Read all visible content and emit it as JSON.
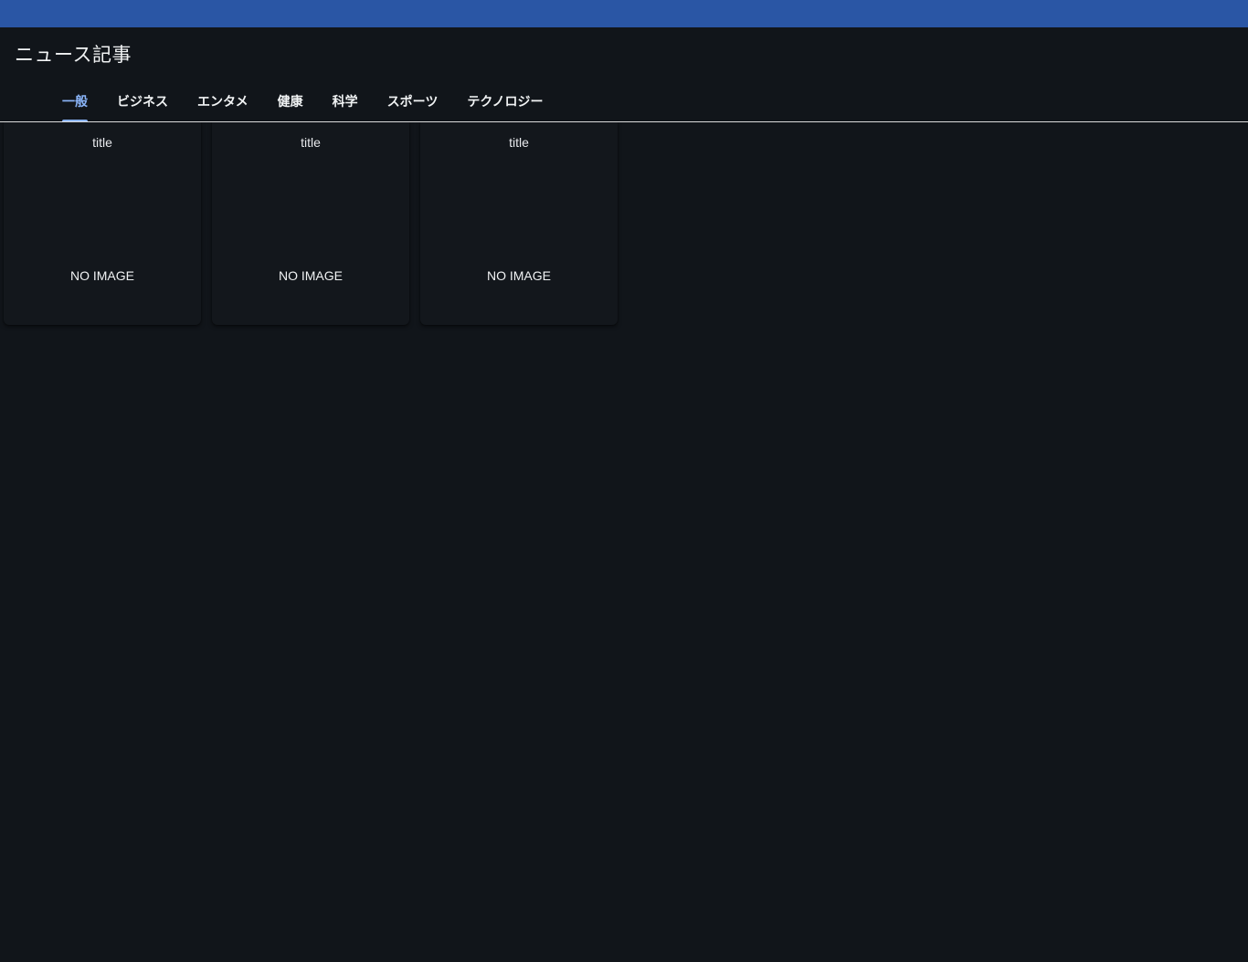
{
  "header": {
    "title": "ニュース記事"
  },
  "tabs": [
    {
      "label": "一般",
      "active": true
    },
    {
      "label": "ビジネス",
      "active": false
    },
    {
      "label": "エンタメ",
      "active": false
    },
    {
      "label": "健康",
      "active": false
    },
    {
      "label": "科学",
      "active": false
    },
    {
      "label": "スポーツ",
      "active": false
    },
    {
      "label": "テクノロジー",
      "active": false
    }
  ],
  "articles": [
    {
      "title": "title",
      "image_placeholder": "NO IMAGE"
    },
    {
      "title": "title",
      "image_placeholder": "NO IMAGE"
    },
    {
      "title": "title",
      "image_placeholder": "NO IMAGE"
    }
  ],
  "colors": {
    "top_bar": "#2a56a5",
    "background": "#11151a",
    "active_tab": "#8ab4f8"
  }
}
